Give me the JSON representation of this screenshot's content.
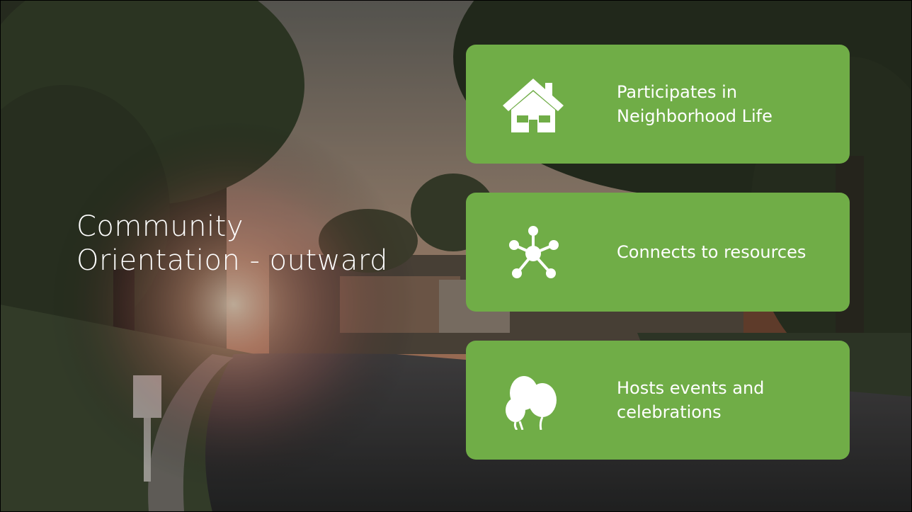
{
  "slide": {
    "title_line1": "Community",
    "title_line2": "Orientation - outward"
  },
  "cards": [
    {
      "label": "Participates in Neighborhood Life",
      "icon": "house-icon"
    },
    {
      "label": "Connects to resources",
      "icon": "network-icon"
    },
    {
      "label": "Hosts events and celebrations",
      "icon": "balloons-icon"
    }
  ],
  "colors": {
    "card_bg": "#70ad47",
    "text": "#ffffff"
  }
}
